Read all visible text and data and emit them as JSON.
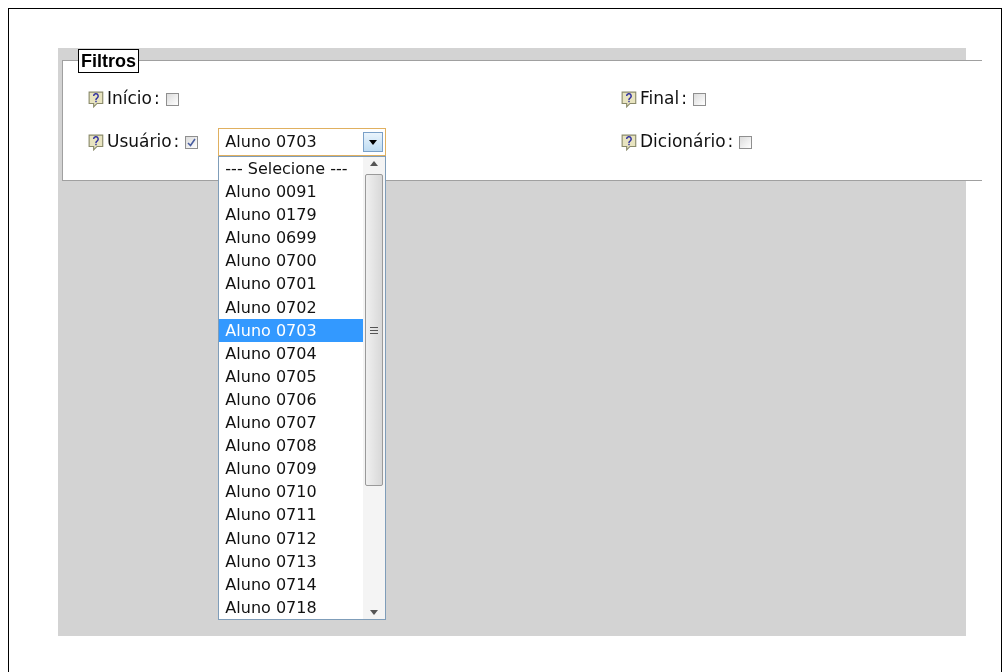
{
  "legend": "Filtros",
  "filters": [
    {
      "label": "Início",
      "separator": ":",
      "checked": false
    },
    {
      "label": "Final",
      "separator": ":",
      "checked": false
    },
    {
      "label": "Usuário",
      "separator": ":",
      "checked": true,
      "select": {
        "value": "Aluno 0703",
        "expanded": true,
        "options": [
          {
            "label": "--- Selecione ---",
            "selected": false
          },
          {
            "label": "Aluno 0091",
            "selected": false
          },
          {
            "label": "Aluno 0179",
            "selected": false
          },
          {
            "label": "Aluno 0699",
            "selected": false
          },
          {
            "label": "Aluno 0700",
            "selected": false
          },
          {
            "label": "Aluno 0701",
            "selected": false
          },
          {
            "label": "Aluno 0702",
            "selected": false
          },
          {
            "label": "Aluno 0703",
            "selected": true
          },
          {
            "label": "Aluno 0704",
            "selected": false
          },
          {
            "label": "Aluno 0705",
            "selected": false
          },
          {
            "label": "Aluno 0706",
            "selected": false
          },
          {
            "label": "Aluno 0707",
            "selected": false
          },
          {
            "label": "Aluno 0708",
            "selected": false
          },
          {
            "label": "Aluno 0709",
            "selected": false
          },
          {
            "label": "Aluno 0710",
            "selected": false
          },
          {
            "label": "Aluno 0711",
            "selected": false
          },
          {
            "label": "Aluno 0712",
            "selected": false
          },
          {
            "label": "Aluno 0713",
            "selected": false
          },
          {
            "label": "Aluno 0714",
            "selected": false
          },
          {
            "label": "Aluno 0718",
            "selected": false
          }
        ]
      }
    },
    {
      "label": "Dicionário",
      "separator": ":",
      "checked": false
    }
  ]
}
